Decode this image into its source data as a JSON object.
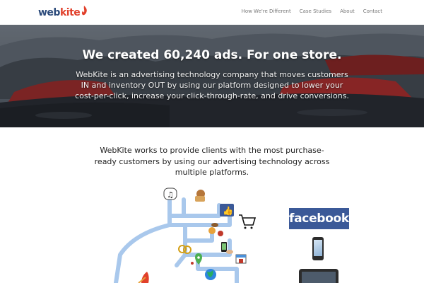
{
  "header": {
    "logo_text": "webkite",
    "nav": [
      "How We're Different",
      "Case Studies",
      "About",
      "Contact"
    ]
  },
  "hero": {
    "title": "We created 60,240 ads. For one store.",
    "text": "WebKite is an advertising technology company that moves customers IN and inventory OUT by using our platform designed to lower your cost-per-click, increase your click-through-rate, and drive conversions."
  },
  "intro": {
    "text": "WebKite works to provide clients with the most purchase-ready customers by using our advertising technology across multiple platforms."
  },
  "platforms": {
    "facebook_label": "facebook"
  },
  "colors": {
    "brand_blue": "#2b4a7a",
    "brand_red": "#e1402b",
    "facebook": "#3b5998",
    "road": "#a9c8ec"
  },
  "icons": [
    "music-note-icon",
    "dog-icon",
    "thumbs-up-icon",
    "shopping-cart-icon",
    "food-icon",
    "rings-icon",
    "phone-hand-icon",
    "map-pin-icon",
    "store-icon",
    "globe-icon",
    "kite-icon"
  ]
}
